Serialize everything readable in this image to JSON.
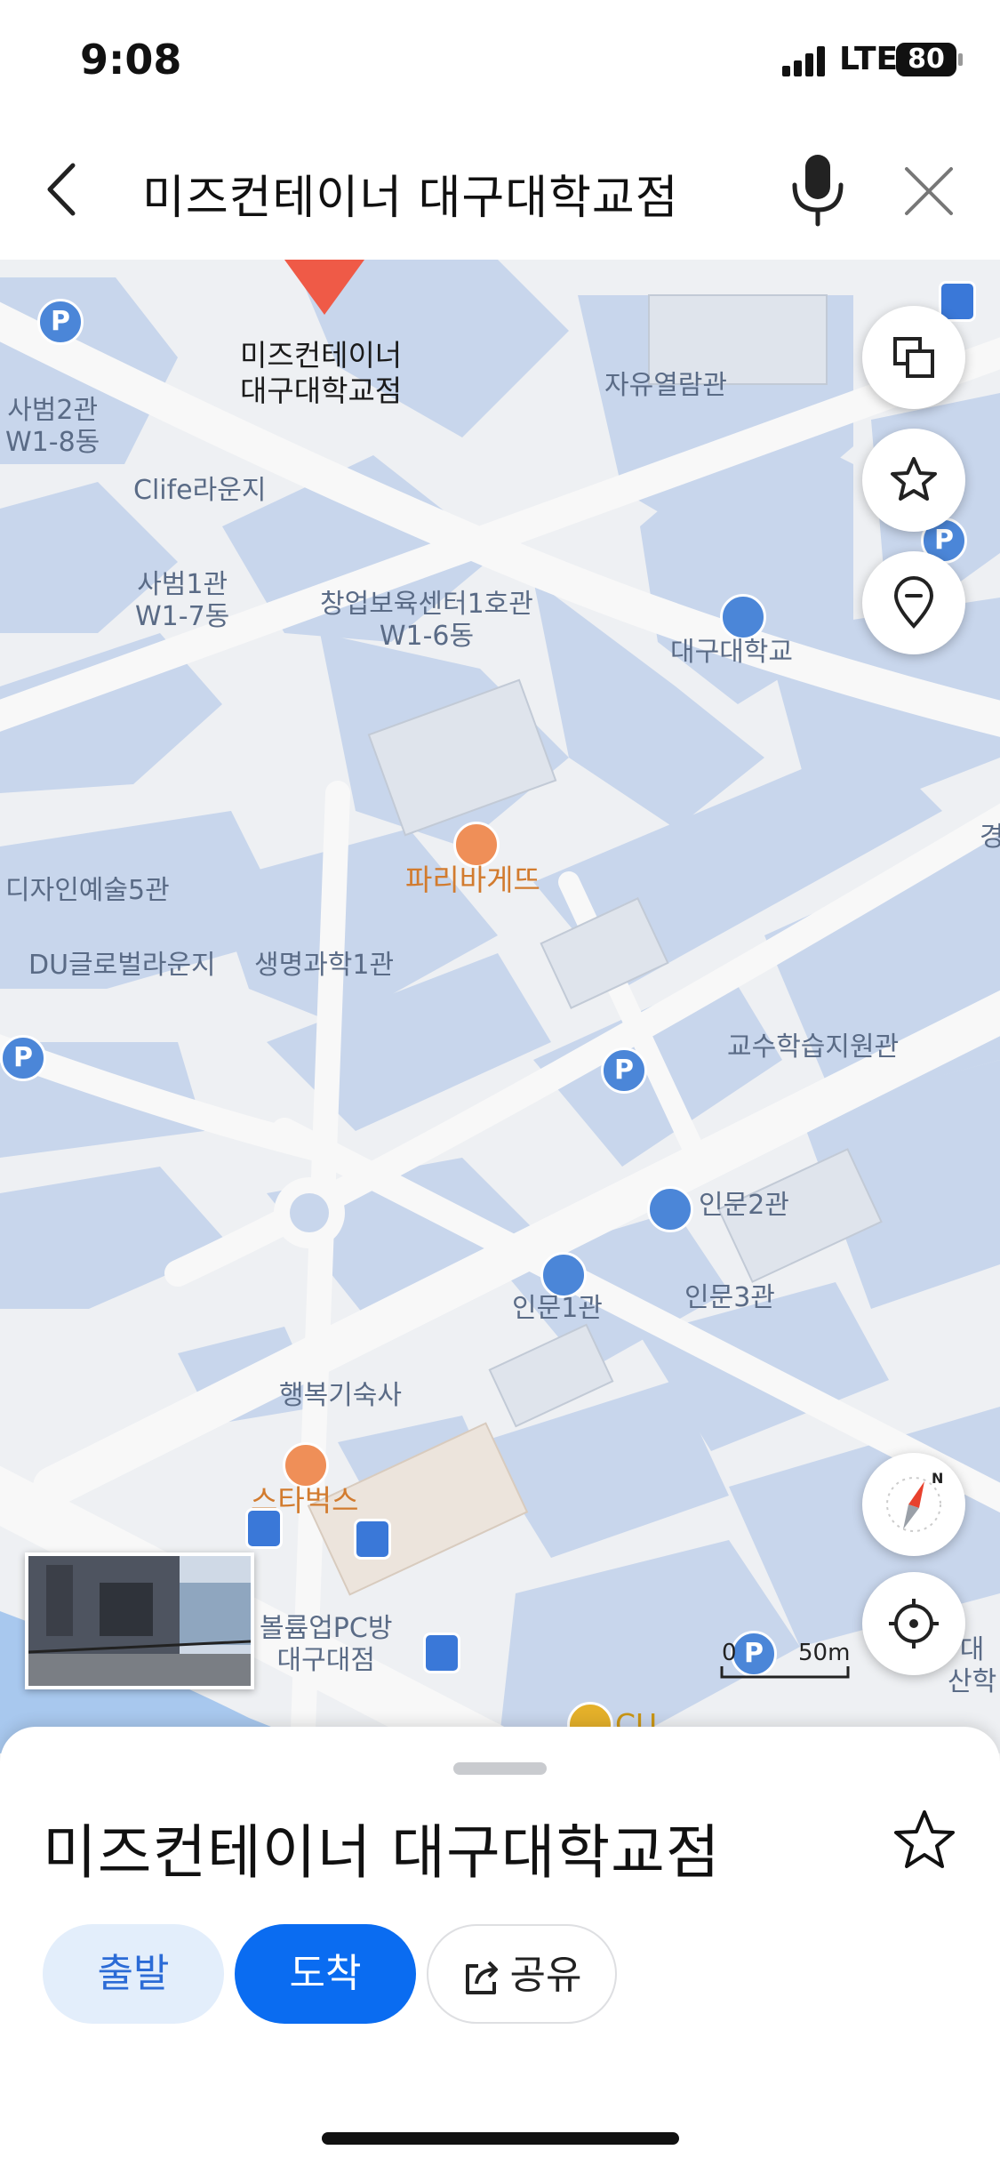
{
  "status_bar": {
    "time": "9:08",
    "network": "LTE",
    "battery": "80"
  },
  "search": {
    "title": "미즈컨테이너 대구대학교점"
  },
  "map": {
    "selected_place": {
      "line1": "미즈컨테이너",
      "line2": "대구대학교점"
    },
    "labels": {
      "sabeom2": {
        "line1": "사범2관",
        "line2": "W1-8동"
      },
      "clife": "Clife라운지",
      "sabeom1": {
        "line1": "사범1관",
        "line2": "W1-7동"
      },
      "startup": {
        "line1": "창업보육센터1호관",
        "line2": "W1-6동"
      },
      "freereading": "자유열람관",
      "daegu_univ": "대구대학교",
      "paris": "파리바게뜨",
      "design5": "디자인예술5관",
      "du_global": "DU글로벌라운지",
      "life_sci": "생명과학1관",
      "prof_support": "교수학습지원관",
      "inmun2": "인문2관",
      "inmun1": "인문1관",
      "inmun3": "인문3관",
      "dorm": "행복기숙사",
      "starbucks": "스타벅스",
      "pcbang": {
        "line1": "볼륨업PC방",
        "line2": "대구대점"
      },
      "cu": "CU",
      "edge_right1": "경",
      "edge_right2": {
        "line1": "대",
        "line2": "산학"
      }
    },
    "parking_symbol": "P",
    "scale": {
      "zero": "0",
      "distance": "50m"
    },
    "compass_letter": "N"
  },
  "sheet": {
    "place_name": "미즈컨테이너 대구대학교점",
    "depart_label": "출발",
    "arrive_label": "도착",
    "share_label": "공유"
  },
  "colors": {
    "accent": "#0a6cf1",
    "map_label": "#5a6b86",
    "poi_orange": "#d27b2e",
    "parking_blue": "#4b86d8"
  },
  "icons": [
    "back-icon",
    "mic-icon",
    "close-icon",
    "layers-icon",
    "star-icon",
    "location-pin-icon",
    "compass-icon",
    "my-location-icon",
    "share-icon"
  ]
}
